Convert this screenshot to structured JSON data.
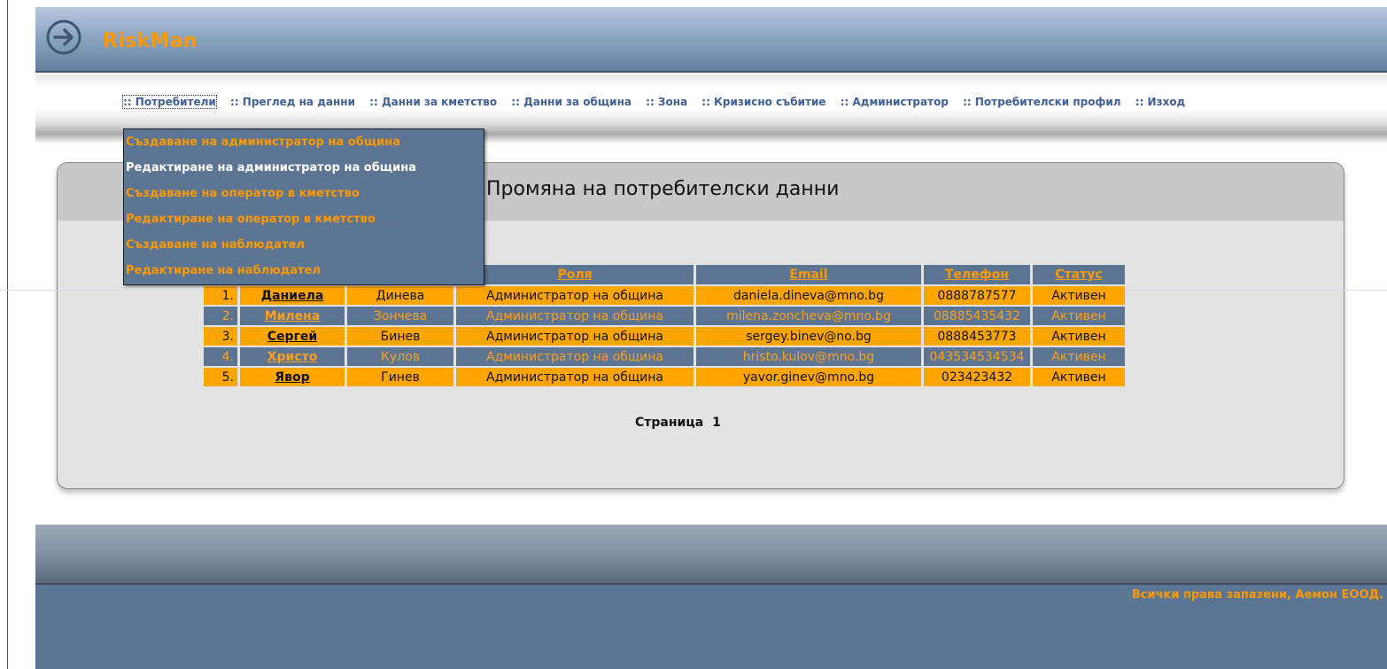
{
  "app": {
    "logo_text": "RiskMan",
    "logo_icon": "circle-arrow-right-icon",
    "accent": "#ff9900",
    "primary": "#5c7593"
  },
  "nav": {
    "items": [
      ":: Потребители",
      ":: Преглед на данни",
      ":: Данни за кметство",
      ":: Данни за община",
      ":: Зона",
      ":: Кризисно събитие",
      ":: Администратор",
      ":: Потребителски профил",
      ":: Изход"
    ]
  },
  "dropdown": {
    "items": [
      "Създаване на администратор на община",
      "Редактиране на администратор на община",
      "Създаване на оператор в кметство",
      "Редактиране на оператор в кметство",
      "Създаване на наблюдател",
      "Редактиране на наблюдател"
    ]
  },
  "panel": {
    "title": "Промяна на потребителски данни"
  },
  "table": {
    "headers": [
      "Роля",
      "Email",
      "Телефон",
      "Статус"
    ],
    "rows": [
      {
        "num": "1.",
        "first": "Даниела",
        "last": "Динева",
        "role": "Администратор на община",
        "email": "daniela.dineva@mno.bg",
        "phone": "0888787577",
        "status": "Активен"
      },
      {
        "num": "2.",
        "first": "Милена",
        "last": "Зончева",
        "role": "Администратор на община",
        "email": "milena.zoncheva@mno.bg",
        "phone": "08885435432",
        "status": "Активен"
      },
      {
        "num": "3.",
        "first": "Сергей",
        "last": "Бинев",
        "role": "Администратор на община",
        "email": "sergey.binev@no.bg",
        "phone": "0888453773",
        "status": "Активен"
      },
      {
        "num": "4.",
        "first": "Христо",
        "last": "Кулов",
        "role": "Администратор на община",
        "email": "hristo.kulov@mno.bg",
        "phone": "043534534534",
        "status": "Активен"
      },
      {
        "num": "5.",
        "first": "Явор",
        "last": "Гинев",
        "role": "Администратор на община",
        "email": "yavor.ginev@mno.bg",
        "phone": "023423432",
        "status": "Активен"
      }
    ]
  },
  "pagination": {
    "label": "Страница",
    "current": "1"
  },
  "footer": {
    "text": "Всички права запазени, Аемон ЕООД."
  }
}
